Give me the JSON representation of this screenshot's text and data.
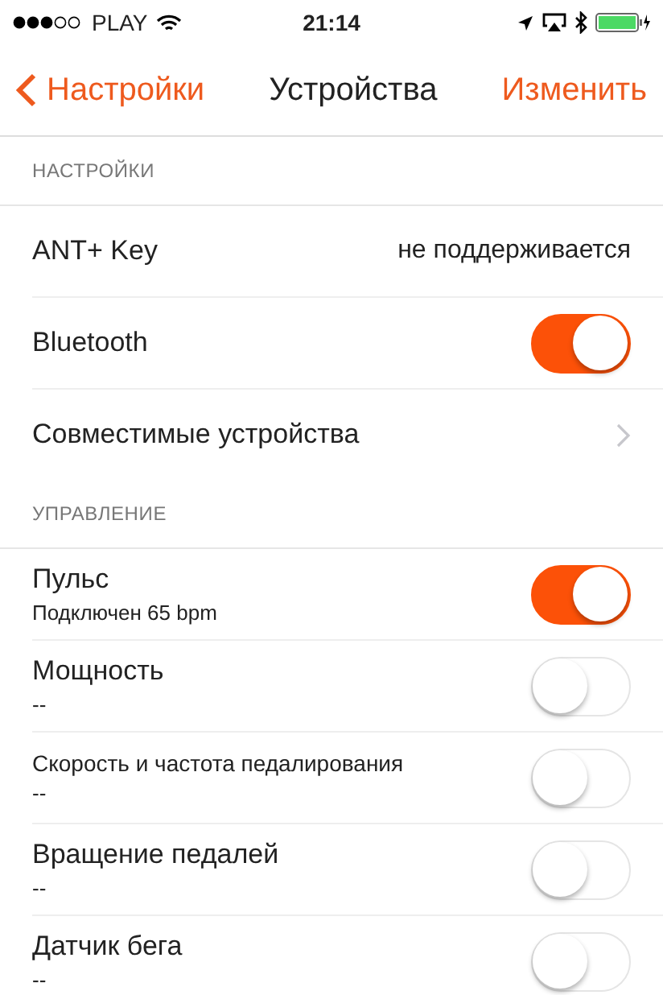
{
  "status_bar": {
    "carrier": "PLAY",
    "time": "21:14"
  },
  "nav": {
    "back": "Настройки",
    "title": "Устройства",
    "action": "Изменить"
  },
  "sections": [
    {
      "title": "НАСТРОЙКИ",
      "items": [
        {
          "kind": "value",
          "label": "ANT+ Key",
          "value": "не поддерживается"
        },
        {
          "kind": "toggle",
          "label": "Bluetooth",
          "on": true
        },
        {
          "kind": "link",
          "label": "Совместимые устройства"
        }
      ]
    },
    {
      "title": "УПРАВЛЕНИЕ",
      "items": [
        {
          "kind": "toggle",
          "label": "Пульс",
          "subtitle": "Подключен 65 bpm",
          "on": true
        },
        {
          "kind": "toggle",
          "label": "Мощность",
          "subtitle": "--",
          "on": false
        },
        {
          "kind": "toggle",
          "label": "Скорость и частота педалирования",
          "subtitle": "--",
          "on": false,
          "small": true
        },
        {
          "kind": "toggle",
          "label": "Вращение педалей",
          "subtitle": "--",
          "on": false
        },
        {
          "kind": "toggle",
          "label": "Датчик бега",
          "subtitle": "--",
          "on": false
        }
      ]
    }
  ]
}
